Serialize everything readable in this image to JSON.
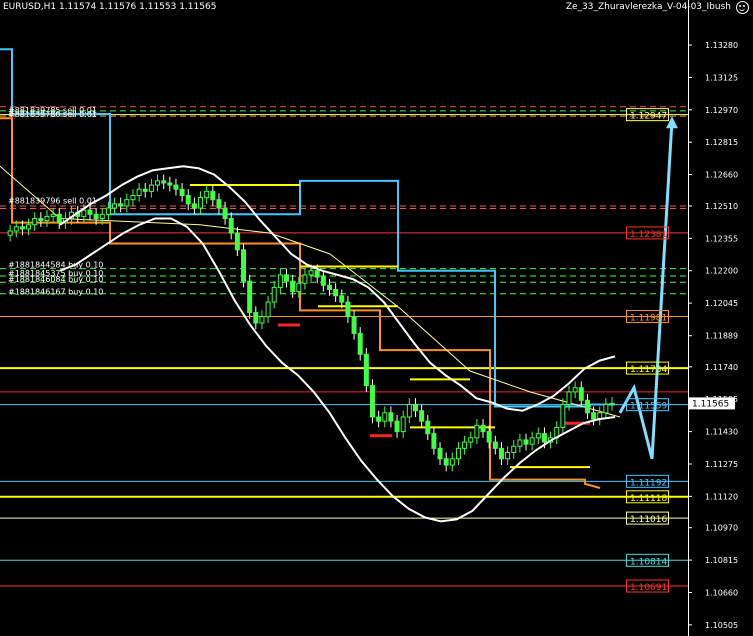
{
  "header": {
    "symbol_info": "EURUSD,H1  1.11574 1.11576 1.11553 1.11565",
    "expert_name": "Ze_33_Zhuravlerezka_V-04-03_Ibush"
  },
  "chart_data": {
    "type": "candlestick",
    "symbol": "EURUSD",
    "timeframe": "H1",
    "ohlc_last": {
      "open": 1.11574,
      "high": 1.11576,
      "low": 1.11553,
      "close": 1.11565
    },
    "ylim": [
      1.1049,
      1.134
    ],
    "y_ticks": [
      "1.13280",
      "1.13125",
      "1.12970",
      "1.12815",
      "1.12660",
      "1.12510",
      "1.12355",
      "1.12200",
      "1.12045",
      "1.11889",
      "1.11740",
      "1.11585",
      "1.11430",
      "1.11275",
      "1.11120",
      "1.10970",
      "1.10815",
      "1.10660",
      "1.10505"
    ],
    "current_price": {
      "label": "1.11565",
      "value": 1.11565
    },
    "price_levels": [
      {
        "label": "1.12947",
        "value": 1.12947,
        "color": "#ffff66",
        "style": "solid"
      },
      {
        "label": "1.12381",
        "value": 1.12381,
        "color": "#ff3030",
        "style": "solid"
      },
      {
        "label": "1.11981",
        "value": 1.11981,
        "color": "#ff9020",
        "style": "solid"
      },
      {
        "label": "1.11734",
        "value": 1.11734,
        "color": "#ffff00",
        "style": "solid",
        "thick": true
      },
      {
        "label": "",
        "value": 1.1162,
        "color": "#ff2020",
        "style": "solid"
      },
      {
        "label": "1.11559",
        "value": 1.11559,
        "color": "#40c8ff",
        "style": "solid"
      },
      {
        "label": "1.11192",
        "value": 1.11192,
        "color": "#40c8ff",
        "style": "solid"
      },
      {
        "label": "1.11118",
        "value": 1.11118,
        "color": "#ffff00",
        "style": "solid",
        "thick": true
      },
      {
        "label": "1.11016",
        "value": 1.11016,
        "color": "#ffff99",
        "style": "solid"
      },
      {
        "label": "1.10814",
        "value": 1.10814,
        "color": "#40e0e0",
        "style": "solid"
      },
      {
        "label": "1.10691",
        "value": 1.10691,
        "color": "#ff3030",
        "style": "solid"
      }
    ],
    "dashed_levels": [
      {
        "value": 1.12985,
        "color": "#ff5050"
      },
      {
        "value": 1.12965,
        "color": "#40ff40"
      },
      {
        "value": 1.1294,
        "color": "#ff9020"
      },
      {
        "value": 1.1251,
        "color": "#ff5050"
      },
      {
        "value": 1.12498,
        "color": "#ff5050"
      },
      {
        "value": 1.1221,
        "color": "#40ff40"
      },
      {
        "value": 1.12175,
        "color": "#40ff40"
      },
      {
        "value": 1.12145,
        "color": "#40ff40"
      },
      {
        "value": 1.1209,
        "color": "#40ff40"
      }
    ],
    "order_labels": [
      {
        "text": "#881839785 sell 0.01",
        "value": 1.1297
      },
      {
        "text": "#881839780 sell 0.01",
        "value": 1.1295
      },
      {
        "text": "#881839796 sell 0.01",
        "value": 1.12535
      },
      {
        "text": "#1881844584 buy 0.10",
        "value": 1.1223
      },
      {
        "text": "#1881845375 buy 0.10",
        "value": 1.1219
      },
      {
        "text": "#1881846084 buy 0.10",
        "value": 1.1216
      },
      {
        "text": "#1881846167 buy 0.10",
        "value": 1.121
      }
    ],
    "close_series": [
      1.1237,
      1.1239,
      1.1241,
      1.124,
      1.1242,
      1.1245,
      1.1244,
      1.1246,
      1.1247,
      1.1243,
      1.1245,
      1.1248,
      1.1246,
      1.1249,
      1.1247,
      1.1245,
      1.1247,
      1.125,
      1.1252,
      1.1251,
      1.1254,
      1.1256,
      1.1259,
      1.1258,
      1.1261,
      1.1263,
      1.1262,
      1.1261,
      1.1259,
      1.1256,
      1.1252,
      1.125,
      1.1255,
      1.1258,
      1.1254,
      1.125,
      1.1245,
      1.1238,
      1.123,
      1.1215,
      1.12,
      1.1195,
      1.1198,
      1.1205,
      1.1212,
      1.1218,
      1.1215,
      1.121,
      1.1214,
      1.1218,
      1.122,
      1.1217,
      1.1213,
      1.1211,
      1.1208,
      1.1205,
      1.1198,
      1.119,
      1.118,
      1.1165,
      1.115,
      1.1148,
      1.1152,
      1.1148,
      1.1143,
      1.115,
      1.1156,
      1.1153,
      1.1148,
      1.1142,
      1.1135,
      1.113,
      1.1127,
      1.113,
      1.1135,
      1.1138,
      1.114,
      1.1146,
      1.1143,
      1.1138,
      1.1135,
      1.113,
      1.1133,
      1.1136,
      1.1139,
      1.1137,
      1.114,
      1.1142,
      1.1138,
      1.114,
      1.1145,
      1.1156,
      1.1162,
      1.1164,
      1.1158,
      1.1152,
      1.1149,
      1.1152,
      1.1156,
      1.11565
    ],
    "bollinger_upper": [
      1.1242,
      1.1247,
      1.1252,
      1.1256,
      1.1261,
      1.1265,
      1.1268,
      1.1269,
      1.127,
      1.1269,
      1.1266,
      1.126,
      1.1253,
      1.1244,
      1.1236,
      1.1228,
      1.1223,
      1.122,
      1.1218,
      1.1216,
      1.1212,
      1.1205,
      1.1195,
      1.1185,
      1.1176,
      1.117,
      1.1165,
      1.1159,
      1.1157,
      1.1154,
      1.1153,
      1.1156,
      1.116,
      1.1166,
      1.1173,
      1.1177,
      1.1179
    ],
    "bollinger_lower": [
      1.122,
      1.1223,
      1.1228,
      1.1233,
      1.1238,
      1.1242,
      1.1245,
      1.1245,
      1.1241,
      1.1233,
      1.122,
      1.1206,
      1.1194,
      1.1184,
      1.1176,
      1.117,
      1.1162,
      1.1152,
      1.114,
      1.1129,
      1.112,
      1.1112,
      1.1106,
      1.1102,
      1.11,
      1.1101,
      1.1105,
      1.1113,
      1.1121,
      1.1128,
      1.1134,
      1.1139,
      1.1143,
      1.1147,
      1.1149,
      1.115
    ],
    "forecast_arrow": [
      1.1152,
      1.1164,
      1.113,
      1.1292
    ]
  }
}
